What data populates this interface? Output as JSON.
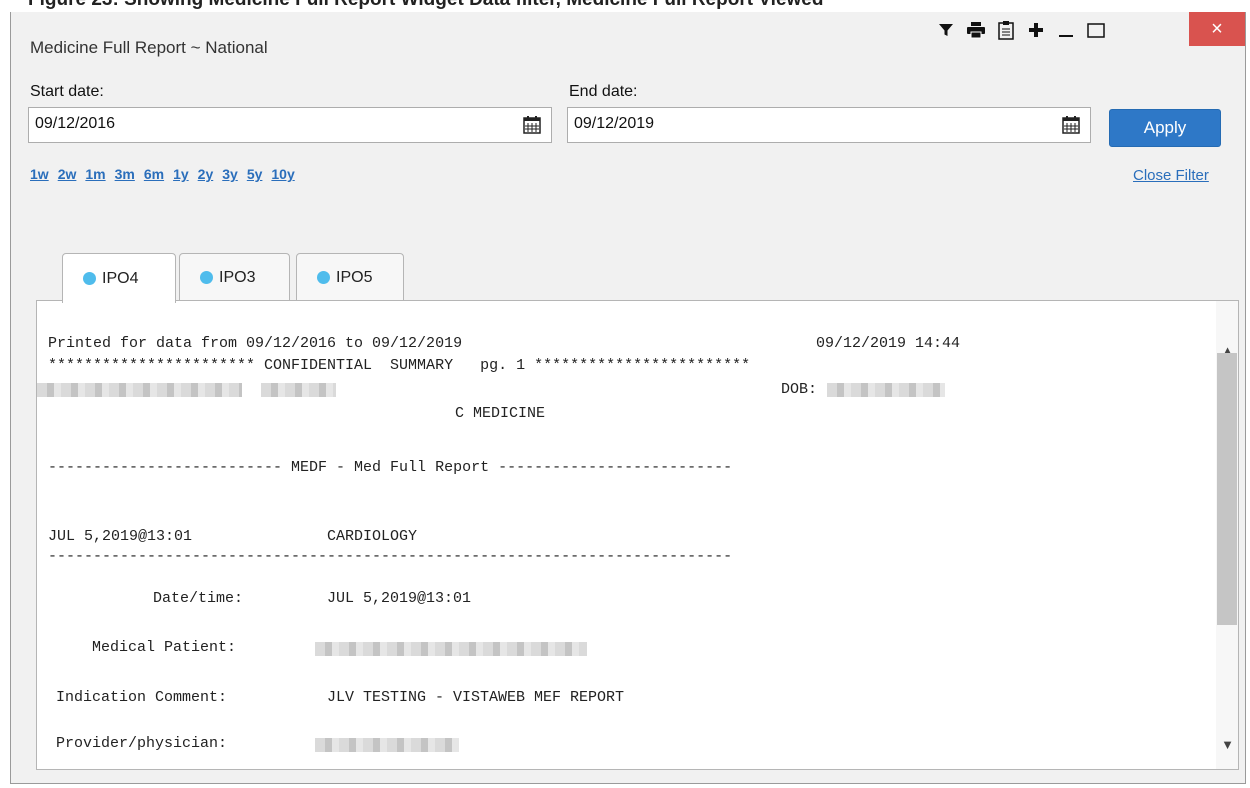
{
  "caption": "Figure 23: Showing Medicine Full Report Widget Data filter, Medicine Full Report Viewed",
  "window": {
    "title": "Medicine Full Report ~ National",
    "toolbar_icons": [
      "filter-icon",
      "print-icon",
      "clipboard-icon",
      "plus-icon",
      "minimize-icon",
      "maximize-icon",
      "close-icon"
    ],
    "close_glyph": "×",
    "close_color": "#d9534f"
  },
  "filter": {
    "start_label": "Start date:",
    "start_value": "09/12/2016",
    "end_label": "End date:",
    "end_value": "09/12/2019",
    "apply_label": "Apply",
    "apply_color": "#2e78c7",
    "ranges": [
      "1w",
      "2w",
      "1m",
      "3m",
      "6m",
      "1y",
      "2y",
      "3y",
      "5y",
      "10y"
    ],
    "close_filter_label": "Close Filter"
  },
  "tabs": [
    {
      "label": "IPO4",
      "active": true
    },
    {
      "label": "IPO3",
      "active": false
    },
    {
      "label": "IPO5",
      "active": false
    }
  ],
  "tab_dot_color": "#4fbcec",
  "report": {
    "printed_line": "Printed for data from 09/12/2016 to 09/12/2019",
    "timestamp": "09/12/2019 14:44",
    "confidential_line": "*********************** CONFIDENTIAL  SUMMARY   pg. 1 ************************",
    "dob_label": "DOB:",
    "section_title": "C MEDICINE",
    "medf_line": "-------------------------- MEDF - Med Full Report --------------------------",
    "entry_datetime": "JUL 5,2019@13:01",
    "entry_specialty": "CARDIOLOGY",
    "rule_line": "----------------------------------------------------------------------------",
    "fields": [
      {
        "label": "Date/time:",
        "value": "JUL 5,2019@13:01"
      },
      {
        "label": "Medical Patient:",
        "value": ""
      },
      {
        "label": "Indication Comment:",
        "value": "JLV TESTING - VISTAWEB MEF REPORT"
      },
      {
        "label": "Provider/physician:",
        "value": ""
      }
    ]
  }
}
